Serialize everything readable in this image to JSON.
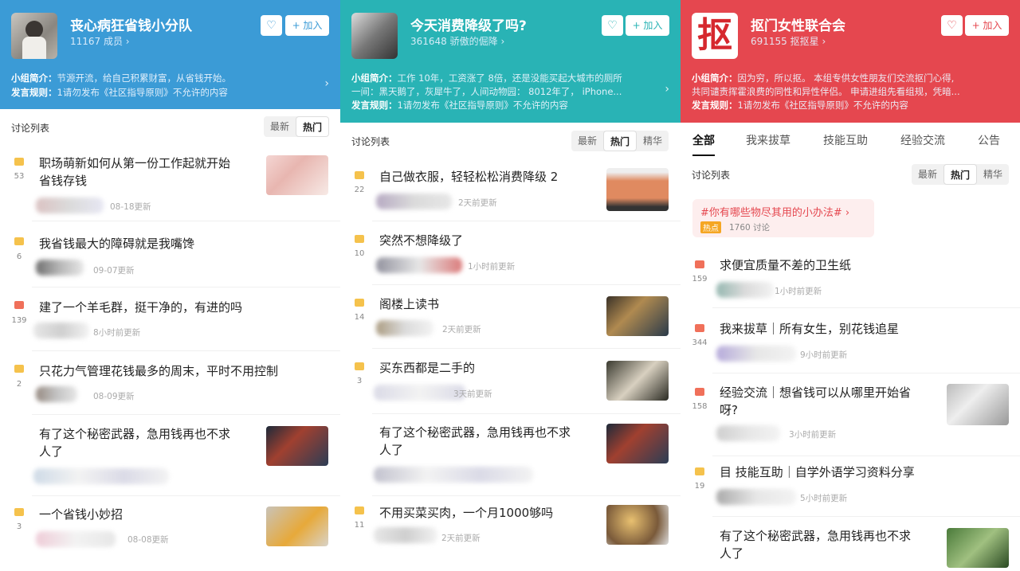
{
  "p1": {
    "title": "丧心病狂省钱小分队",
    "members": "11167 成员 ›",
    "fav": "♡",
    "join": "+ 加入",
    "intro_label": "小组简介：",
    "intro_text": "节源开流，给自己积累财富，从省钱开始。",
    "rule_label": "发言规则：",
    "rule_text": "1请勿发布《社区指导原则》不允许的内容",
    "list_title": "讨论列表",
    "sort": [
      "最新",
      "热门"
    ],
    "posts": [
      {
        "count": "53",
        "title1": "职场萌新如何从第一份工作起就开始",
        "title2": "省钱存钱",
        "meta": "08-18更新"
      },
      {
        "count": "6",
        "title1": "我省钱最大的障碍就是我嘴馋",
        "title2": "",
        "meta": "09-07更新"
      },
      {
        "count": "139",
        "title1": "建了一个羊毛群，挺干净的，有进的吗",
        "title2": "",
        "meta": "8小时前更新"
      },
      {
        "count": "2",
        "title1": "只花力气管理花钱最多的周末，平时不用控制",
        "title2": "",
        "meta": "08-09更新"
      },
      {
        "count": "",
        "title1": "有了这个秘密武器，急用钱再也不求",
        "title2": "人了",
        "meta": ""
      },
      {
        "count": "3",
        "title1": "一个省钱小妙招",
        "title2": "",
        "meta": "08-08更新"
      }
    ]
  },
  "p2": {
    "title": "今天消费降级了吗?",
    "members": "361648 骄傲的倔降 ›",
    "fav": "♡",
    "join": "+ 加入",
    "intro_label": "小组简介：",
    "intro_text": "工作 10年，工资涨了 8倍，还是没能买起大城市的厕所",
    "intro_text2": "一间：黑天鹅了，灰犀牛了，人间动物园：  8012年了， iPhone...",
    "rule_label": "发言规则：",
    "rule_text": "1请勿发布《社区指导原则》不允许的内容",
    "list_title": "讨论列表",
    "sort": [
      "最新",
      "热门",
      "精华"
    ],
    "posts": [
      {
        "count": "22",
        "title1": "自己做衣服，轻轻松松消费降级 2",
        "meta": "2天前更新"
      },
      {
        "count": "10",
        "title1": "突然不想降级了",
        "meta": "1小时前更新"
      },
      {
        "count": "14",
        "title1": "阁楼上读书",
        "meta": "2天前更新"
      },
      {
        "count": "3",
        "title1": "买东西都是二手的",
        "meta": "3天前更新"
      },
      {
        "count": "",
        "title1": "有了这个秘密武器，急用钱再也不求",
        "title2": "人了",
        "meta": ""
      },
      {
        "count": "11",
        "title1": "不用买菜买肉，一个月1000够吗",
        "meta": "2天前更新"
      }
    ]
  },
  "p3": {
    "title": "抠门女性联合会",
    "members": "691155 抠抠星 ›",
    "fav": "♡",
    "join": "+ 加入",
    "logo": "抠",
    "intro_label": "小组简介：",
    "intro_text": "因为穷，所以抠。 本组专供女性朋友们交流抠门心得,",
    "intro_text2": "共同谴责挥霍浪费的同性和异性伴侣。 申请进组先看组规，凭暗...",
    "rule_label": "发言规则：",
    "rule_text": "1请勿发布《社区指导原则》不允许的内容",
    "tabs": [
      "全部",
      "我来拔草",
      "技能互助",
      "经验交流",
      "公告"
    ],
    "list_title": "讨论列表",
    "sort": [
      "最新",
      "热门",
      "精华"
    ],
    "topic": "#你有哪些物尽其用的小办法# ›",
    "hot": "热点",
    "topic_meta": "1760 讨论",
    "posts": [
      {
        "count": "159",
        "title1": "求便宜质量不差的卫生纸",
        "meta": "1小时前更新"
      },
      {
        "count": "344",
        "title1": "我来拔草｜所有女生，别花钱追星",
        "meta": "9小时前更新"
      },
      {
        "count": "158",
        "title1": "经验交流｜想省钱可以从哪里开始省",
        "title2": "呀?",
        "meta": "3小时前更新"
      },
      {
        "count": "19",
        "title1": "目 技能互助｜自学外语学习资料分享",
        "meta": "5小时前更新"
      },
      {
        "count": "",
        "title1": "有了这个秘密武器，急用钱再也不求",
        "title2": "人了",
        "meta": ""
      }
    ]
  },
  "colors": {
    "p1": "#3b9bd6",
    "p2": "#29b3b5",
    "p3": "#e5474f",
    "icon_orange": "#f0705a",
    "icon_yellow": "#f5c24c"
  }
}
